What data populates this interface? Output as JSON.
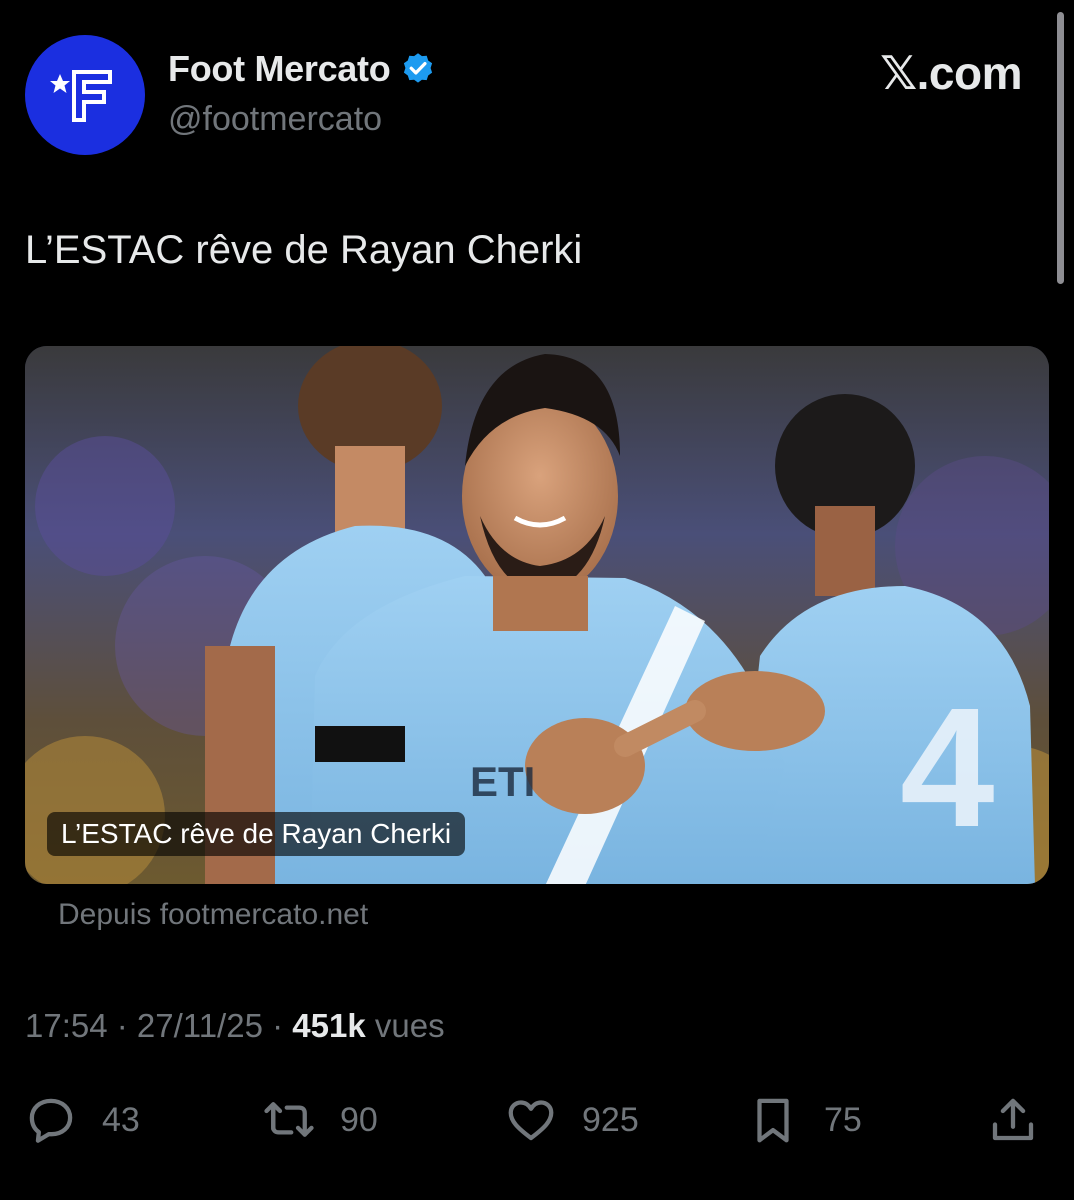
{
  "author": {
    "display_name": "Foot Mercato",
    "handle": "@footmercato",
    "avatar_icon": "footmercato-logo",
    "verified_icon": "verified-badge-icon",
    "avatar_color": "#1b2fe0",
    "verified_color": "#1d9bf0"
  },
  "site_logo": "𝕏.com",
  "tweet": {
    "text": "L’ESTAC rêve de Rayan Cherki"
  },
  "card": {
    "caption": "L’ESTAC rêve de Rayan Cherki",
    "source": "Depuis footmercato.net"
  },
  "meta": {
    "time": "17:54",
    "separator": " · ",
    "date": "27/11/25",
    "views_count": "451k",
    "views_label": "vues"
  },
  "actions": {
    "replies": {
      "icon": "reply-icon",
      "count": "43"
    },
    "reposts": {
      "icon": "repost-icon",
      "count": "90"
    },
    "likes": {
      "icon": "heart-icon",
      "count": "925"
    },
    "bookmarks": {
      "icon": "bookmark-icon",
      "count": "75"
    },
    "share": {
      "icon": "share-icon"
    }
  },
  "colors": {
    "background": "#000000",
    "primary_text": "#e7e9ea",
    "secondary_text": "#71767b",
    "jersey_blue": "#8fc3ea"
  }
}
